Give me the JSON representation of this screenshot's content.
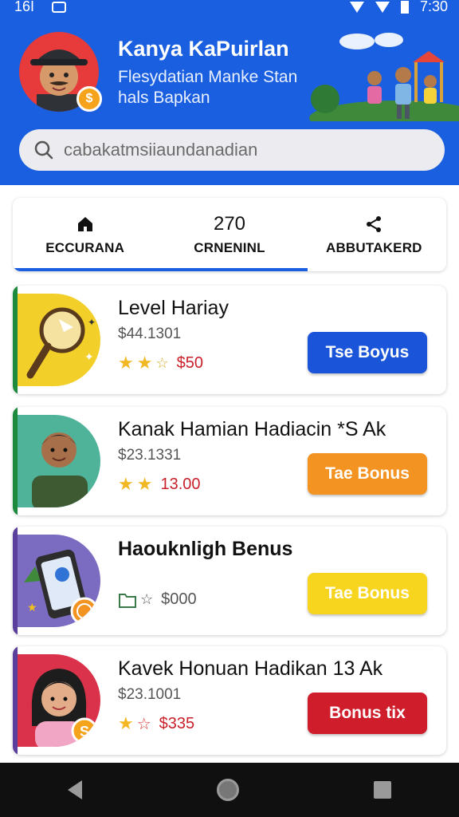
{
  "status_bar": {
    "time_left": "16I",
    "time_right": "7:30"
  },
  "header": {
    "title": "Kanya KaPuirlan",
    "subtitle": "Flesydatian Manke Stan hals Bapkan"
  },
  "search": {
    "placeholder": "cabakatmsiiaundanadian"
  },
  "tabs": [
    {
      "top": "",
      "icon": "home-icon",
      "label": "ECCURANA"
    },
    {
      "top": "270",
      "icon": "",
      "label": "CRNENINL"
    },
    {
      "top": "",
      "icon": "share-icon",
      "label": "ABBUTAKERD"
    }
  ],
  "cards": [
    {
      "title": "Level Hariay",
      "price": "$44.1301",
      "amount": "$50",
      "button": "Tse Boyus",
      "accent": "#1e8a3e",
      "button_color": "#1a55d9"
    },
    {
      "title": "Kanak Hamian Hadiacin *S Ak",
      "price": "$23.1331",
      "amount": "13.00",
      "button": "Tae Bonus",
      "accent": "#1e8a3e",
      "button_color": "#f39322"
    },
    {
      "title": "Haouknligh Benus",
      "price": "",
      "amount": "$000",
      "button": "Tae Bonus",
      "accent": "#5b3f9c",
      "button_color": "#f7d51e"
    },
    {
      "title": "Kavek Honuan Hadikan 13 Ak",
      "price": "$23.1001",
      "amount": "$335",
      "button": "Bonus tix",
      "accent": "#5b3f9c",
      "button_color": "#cf1d2b"
    }
  ]
}
